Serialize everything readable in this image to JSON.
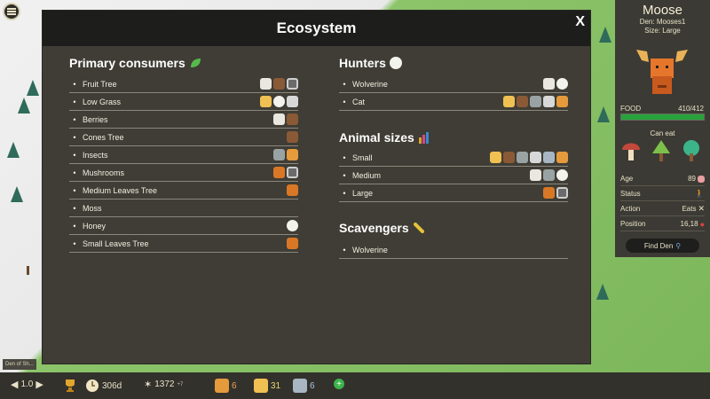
{
  "window": {
    "title": "Ecosystem",
    "close_label": "X"
  },
  "primary": {
    "title": "Primary consumers",
    "items": [
      {
        "name": "Fruit Tree",
        "icon": "apple-icon",
        "animals": [
          "cat",
          "bear",
          "wolverine"
        ]
      },
      {
        "name": "Low Grass",
        "icon": "grass-icon",
        "animals": [
          "dog",
          "owl",
          "rabbit"
        ]
      },
      {
        "name": "Berries",
        "icon": "berries-icon",
        "animals": [
          "cat",
          "bear"
        ]
      },
      {
        "name": "Cones Tree",
        "icon": "cone-icon",
        "animals": [
          "bear"
        ]
      },
      {
        "name": "Insects",
        "icon": "insect-icon",
        "animals": [
          "raccoon",
          "fox"
        ]
      },
      {
        "name": "Mushrooms",
        "icon": "mushroom-icon",
        "animals": [
          "moose",
          "wolverine"
        ]
      },
      {
        "name": "Medium Leaves Tree",
        "icon": "tree-icon",
        "animals": [
          "moose"
        ]
      },
      {
        "name": "Moss",
        "icon": "moss-icon",
        "animals": []
      },
      {
        "name": "Honey",
        "icon": "honey-icon",
        "animals": [
          "owl"
        ]
      },
      {
        "name": "Small Leaves Tree",
        "icon": "small-tree-icon",
        "animals": [
          "moose"
        ]
      }
    ]
  },
  "hunters": {
    "title": "Hunters",
    "items": [
      {
        "name": "Wolverine",
        "icon": "wolverine-icon",
        "animals": [
          "cat",
          "owl"
        ]
      },
      {
        "name": "Cat",
        "icon": "cat-icon",
        "animals": [
          "dog",
          "bear",
          "raccoon",
          "rabbit",
          "fox"
        ]
      }
    ]
  },
  "sizes": {
    "title": "Animal sizes",
    "items": [
      {
        "name": "Small",
        "icon": "small-size-icon",
        "animals": [
          "dog",
          "bear",
          "raccoon",
          "rabbit",
          "wolf",
          "fox"
        ]
      },
      {
        "name": "Medium",
        "icon": "medium-size-icon",
        "animals": [
          "cat",
          "raccoon",
          "owl"
        ]
      },
      {
        "name": "Large",
        "icon": "large-size-icon",
        "animals": [
          "moose",
          "wolverine"
        ]
      }
    ]
  },
  "scavengers": {
    "title": "Scavengers",
    "items": [
      {
        "name": "Wolverine",
        "icon": "wolverine-icon",
        "animals": []
      }
    ]
  },
  "side": {
    "name": "Moose",
    "den": "Den: Mooses1",
    "size": "Size: Large",
    "food_label": "FOOD",
    "food_value": "410/412",
    "food_fraction": 0.995,
    "can_eat_label": "Can eat",
    "stats": [
      {
        "label": "Age",
        "value": "89"
      },
      {
        "label": "Status",
        "value": ""
      },
      {
        "label": "Action",
        "value": "Eats"
      },
      {
        "label": "Position",
        "value": "16,18"
      }
    ],
    "find_den": "Find Den"
  },
  "bottom": {
    "speed": "1.0",
    "days": "306d",
    "score": "1372",
    "score_delta": "+7",
    "count_fox": "6",
    "count_bear": "31",
    "count_wolf": "6"
  },
  "den_tag": "Den of Sh..."
}
